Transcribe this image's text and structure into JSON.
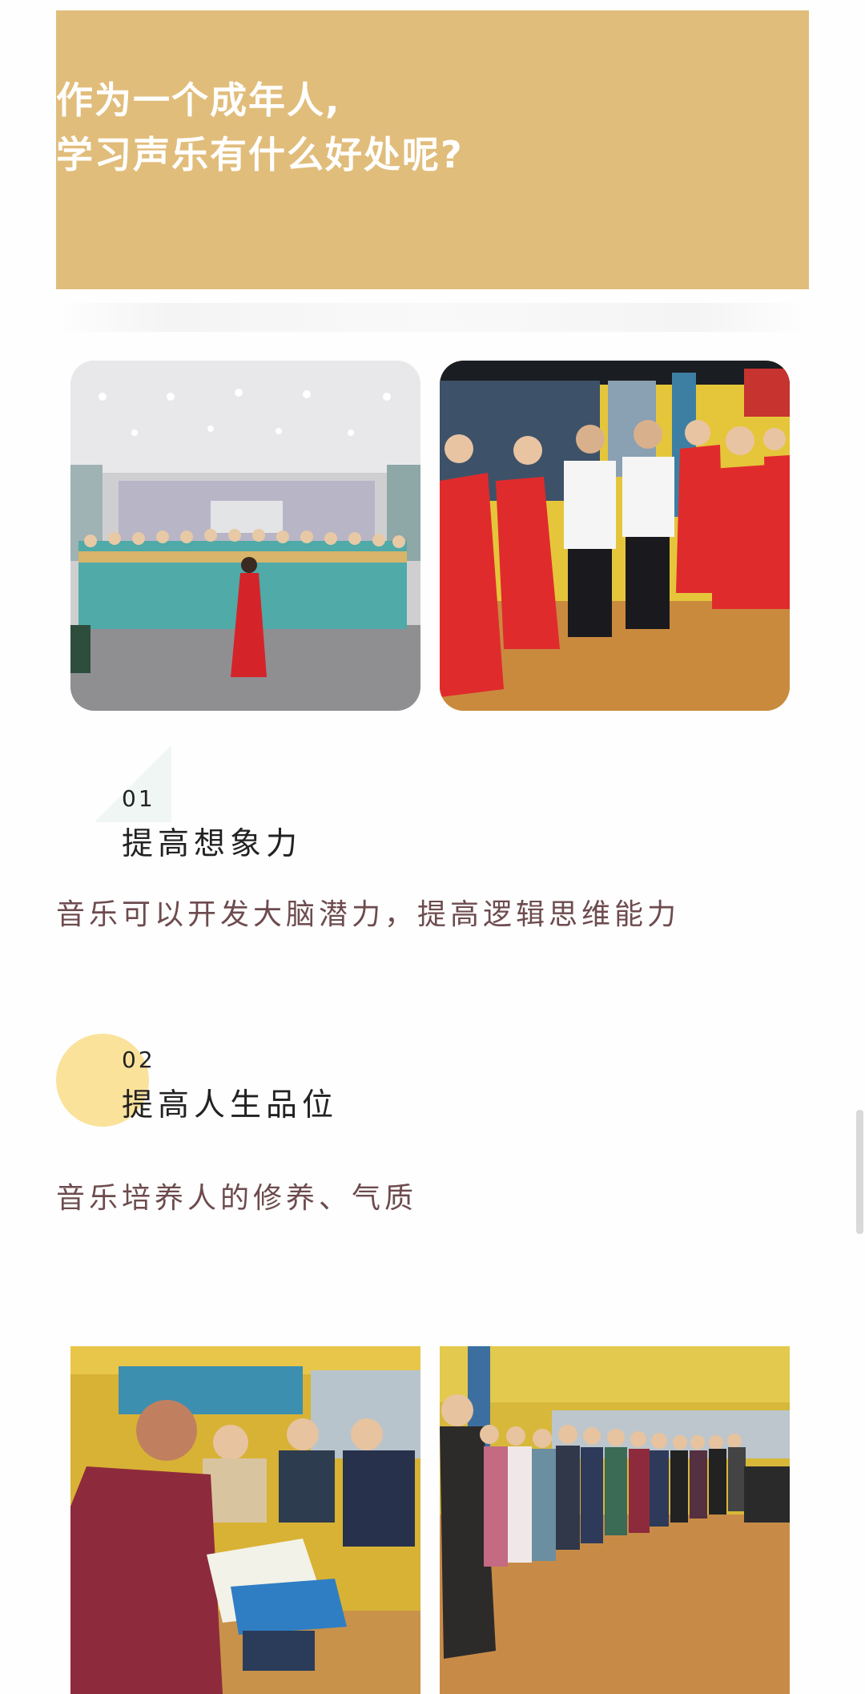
{
  "banner": {
    "title_line1": "作为一个成年人,",
    "title_line2": "学习声乐有什么好处呢?",
    "color": "#e1bd7b"
  },
  "photos": [
    {
      "name": "choir-teal-dresses-photo"
    },
    {
      "name": "choir-red-dresses-photo"
    },
    {
      "name": "reading-scores-photo"
    },
    {
      "name": "standing-line-photo"
    }
  ],
  "sections": [
    {
      "number": "01",
      "heading": "提高想象力",
      "description": "音乐可以开发大脑潜力，提高逻辑思维能力"
    },
    {
      "number": "02",
      "heading": "提高人生品位",
      "description": "音乐培养人的修养、气质"
    }
  ],
  "colors": {
    "text_dark": "#222222",
    "text_desc": "#6d4b4e",
    "accent_circle": "#fae29b"
  }
}
